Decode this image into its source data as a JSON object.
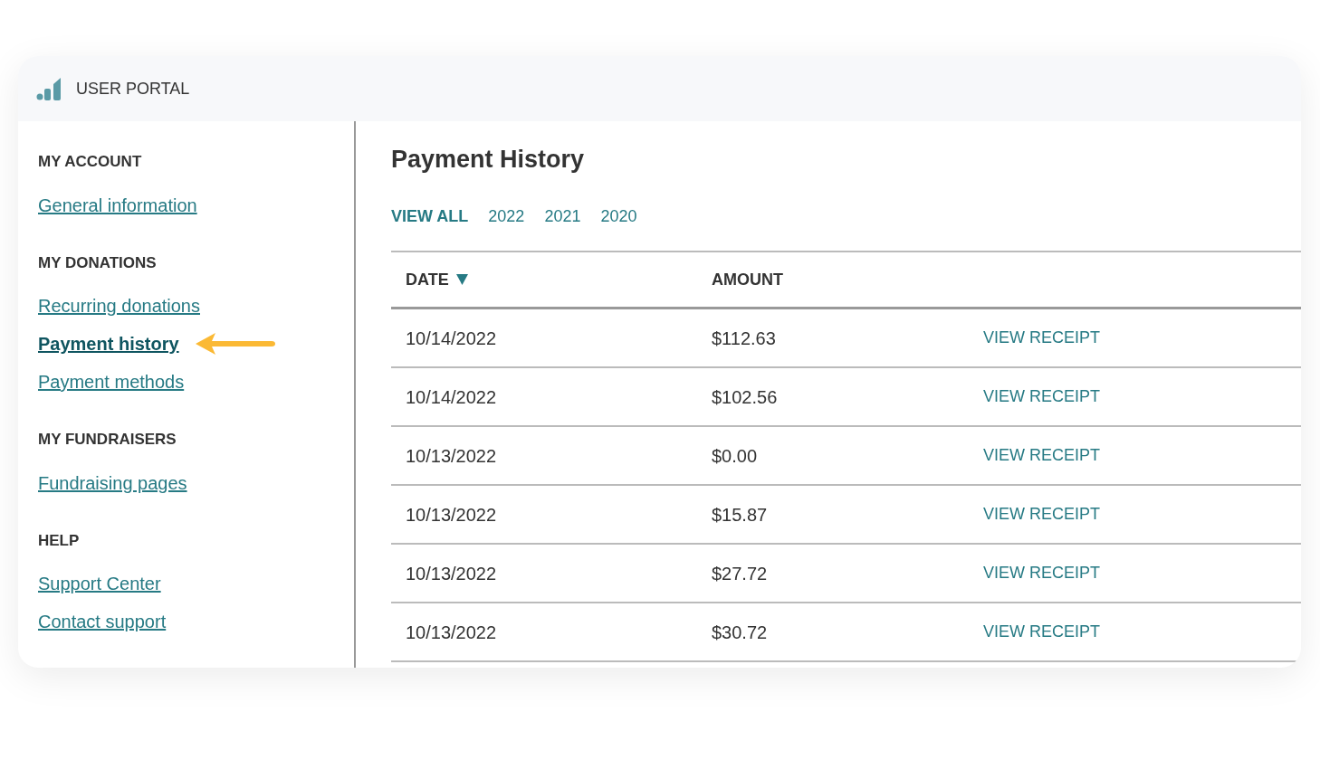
{
  "header": {
    "title": "USER PORTAL"
  },
  "sidebar": {
    "sections": [
      {
        "heading": "MY ACCOUNT",
        "links": [
          {
            "label": "General information",
            "selected": false
          }
        ]
      },
      {
        "heading": "MY DONATIONS",
        "links": [
          {
            "label": "Recurring donations",
            "selected": false
          },
          {
            "label": "Payment history",
            "selected": true,
            "pointer": true
          },
          {
            "label": "Payment methods",
            "selected": false
          }
        ]
      },
      {
        "heading": "MY FUNDRAISERS",
        "links": [
          {
            "label": "Fundraising pages",
            "selected": false
          }
        ]
      },
      {
        "heading": "HELP",
        "links": [
          {
            "label": "Support Center",
            "selected": false
          },
          {
            "label": "Contact support",
            "selected": false
          }
        ]
      }
    ]
  },
  "main": {
    "title": "Payment History",
    "filters": [
      {
        "label": "VIEW ALL",
        "selected": true
      },
      {
        "label": "2022",
        "selected": false
      },
      {
        "label": "2021",
        "selected": false
      },
      {
        "label": "2020",
        "selected": false
      }
    ],
    "table": {
      "columns": [
        {
          "label": "DATE",
          "sorted": true
        },
        {
          "label": "AMOUNT"
        }
      ],
      "rows": [
        {
          "date": "10/14/2022",
          "amount": "$112.63",
          "action": "VIEW RECEIPT"
        },
        {
          "date": "10/14/2022",
          "amount": "$102.56",
          "action": "VIEW RECEIPT"
        },
        {
          "date": "10/13/2022",
          "amount": "$0.00",
          "action": "VIEW RECEIPT"
        },
        {
          "date": "10/13/2022",
          "amount": "$15.87",
          "action": "VIEW RECEIPT"
        },
        {
          "date": "10/13/2022",
          "amount": "$27.72",
          "action": "VIEW RECEIPT"
        },
        {
          "date": "10/13/2022",
          "amount": "$30.72",
          "action": "VIEW RECEIPT"
        }
      ]
    }
  }
}
